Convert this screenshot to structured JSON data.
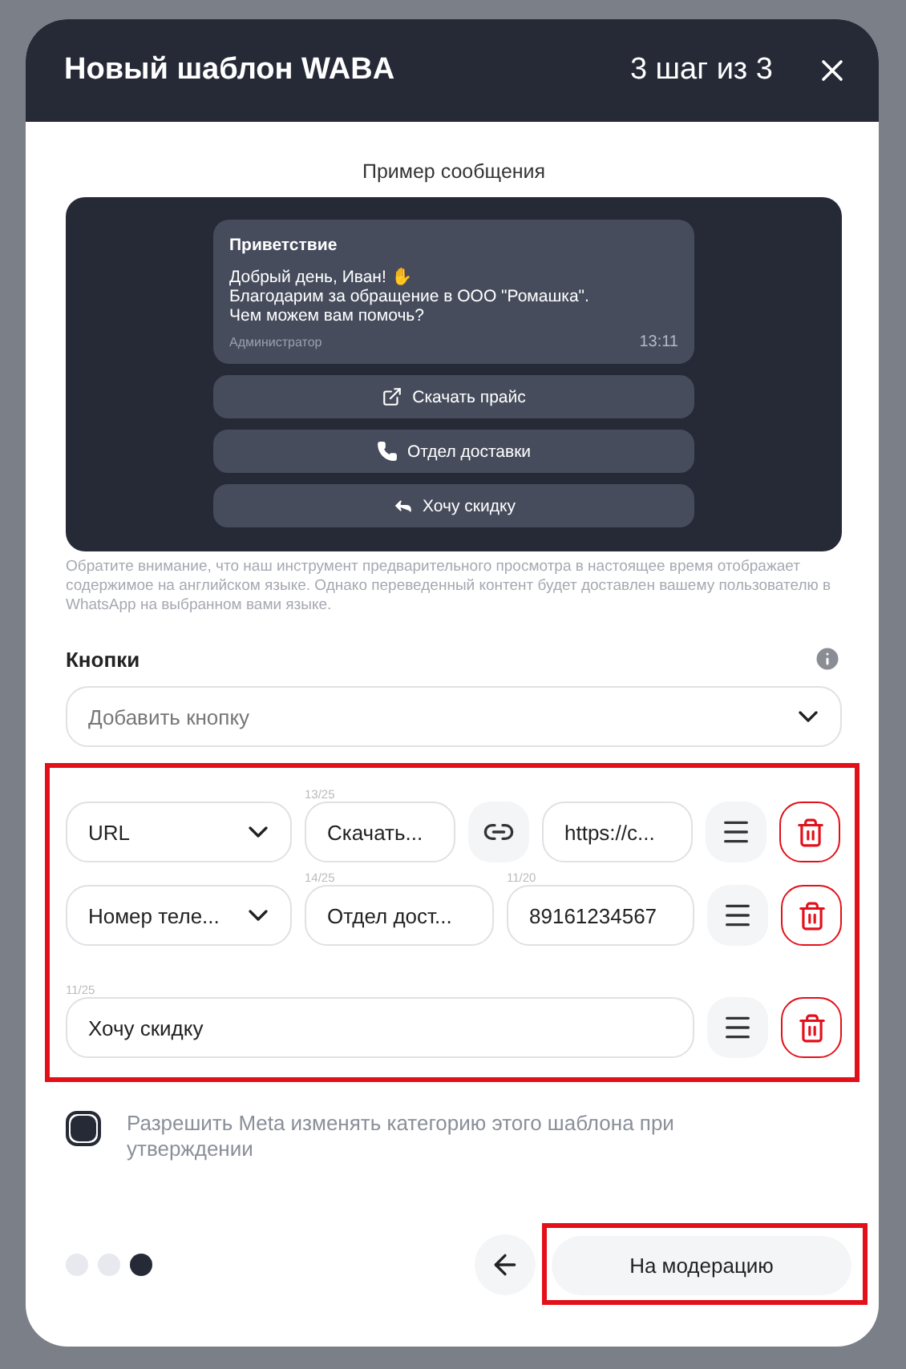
{
  "modal": {
    "title": "Новый шаблон WABA",
    "step": "3 шаг из 3"
  },
  "preview": {
    "label": "Пример сообщения",
    "header": "Приветствие",
    "body": [
      "Добрый день, Иван! ✋",
      "Благодарим за обращение в ООО \"Ромашка\".",
      "Чем можем вам помочь?"
    ],
    "sender": "Администратор",
    "time": "13:11",
    "buttons": [
      {
        "kind": "link",
        "label": "Скачать прайс"
      },
      {
        "kind": "phone",
        "label": "Отдел доставки"
      },
      {
        "kind": "reply",
        "label": "Хочу скидку"
      }
    ],
    "note": "Обратите внимание, что наш инструмент предварительного просмотра в настоящее время отображает содержимое на английском языке. Однако переведенный контент будет доставлен вашему пользователю в WhatsApp на выбранном вами языке."
  },
  "buttons_section": {
    "title": "Кнопки",
    "add_placeholder": "Добавить кнопку",
    "highlighted": true,
    "rows": [
      {
        "kind": "url",
        "type": "URL",
        "text": {
          "counter": "13/25",
          "value": "Скачать..."
        },
        "target": {
          "value": "https://c..."
        }
      },
      {
        "kind": "phone",
        "type": "Номер теле...",
        "text": {
          "counter": "14/25",
          "value": "Отдел дост..."
        },
        "target": {
          "counter": "11/20",
          "value": "89161234567"
        }
      },
      {
        "kind": "reply",
        "text": {
          "counter": "11/25",
          "value": "Хочу скидку"
        }
      }
    ]
  },
  "allow_meta": {
    "label": "Разрешить Meta изменять категорию этого шаблона при утверждении",
    "checked": true
  },
  "footer": {
    "steps": [
      {
        "selected": false
      },
      {
        "selected": false
      },
      {
        "selected": true
      }
    ],
    "submit": {
      "label": "На модерацию",
      "highlighted": true
    }
  }
}
